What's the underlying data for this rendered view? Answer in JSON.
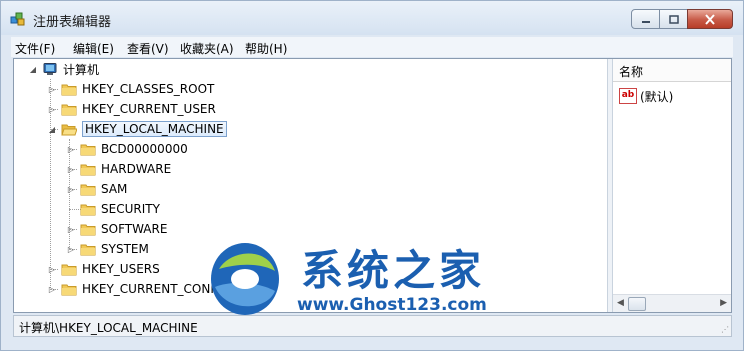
{
  "window": {
    "title": "注册表编辑器"
  },
  "menu": [
    "文件(F)",
    "编辑(E)",
    "查看(V)",
    "收藏夹(A)",
    "帮助(H)"
  ],
  "tree": {
    "root": "计算机",
    "hives": [
      "HKEY_CLASSES_ROOT",
      "HKEY_CURRENT_USER",
      "HKEY_LOCAL_MACHINE"
    ],
    "subkeys": [
      "BCD00000000",
      "HARDWARE",
      "SAM",
      "SECURITY",
      "SOFTWARE",
      "SYSTEM"
    ],
    "hives_after": [
      "HKEY_USERS",
      "HKEY_CURRENT_CONFIG"
    ]
  },
  "values": {
    "column": "名称",
    "row": "(默认)",
    "row_icon": "ab"
  },
  "status": "计算机\\HKEY_LOCAL_MACHINE",
  "watermark": {
    "title": "系统之家",
    "url": "www.Ghost123.com"
  }
}
